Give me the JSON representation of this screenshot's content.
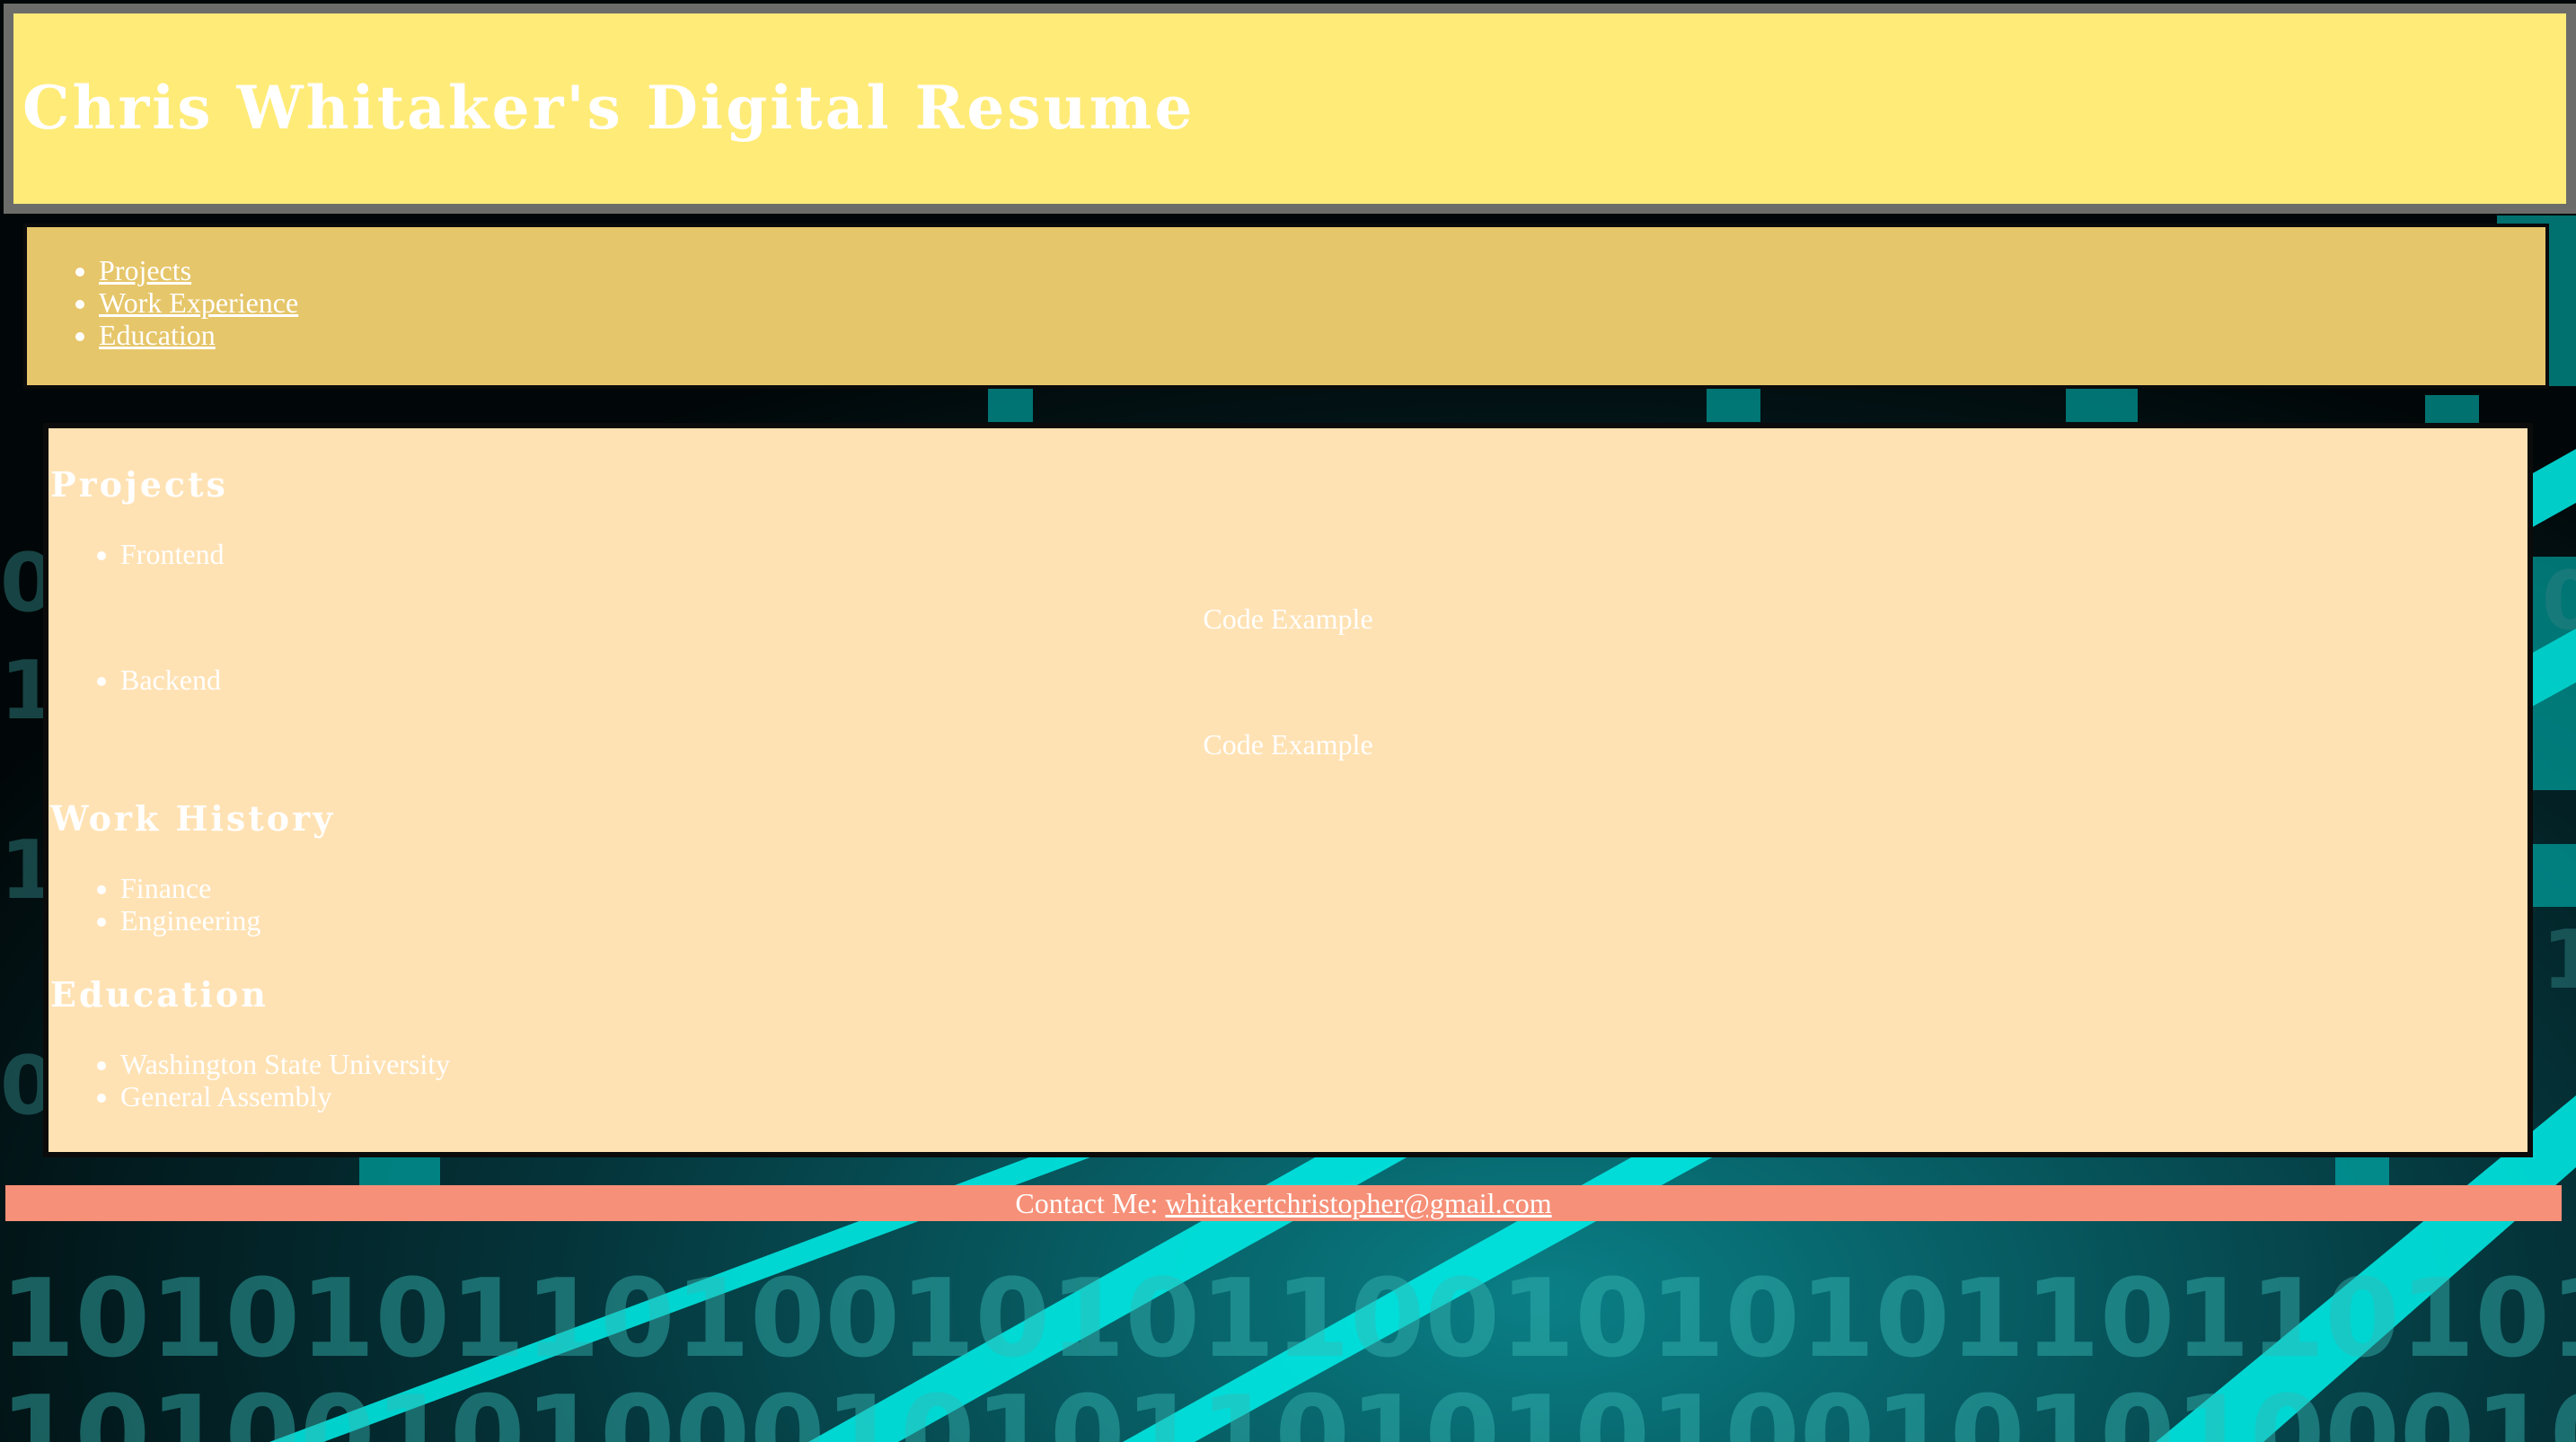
{
  "header": {
    "title": "Chris Whitaker's Digital Resume"
  },
  "nav": {
    "items": [
      {
        "label": "Projects"
      },
      {
        "label": "Work Experience"
      },
      {
        "label": "Education"
      }
    ]
  },
  "main": {
    "projects": {
      "heading": "Projects",
      "items": [
        {
          "label": "Frontend",
          "example": "Code Example"
        },
        {
          "label": "Backend",
          "example": "Code Example"
        }
      ]
    },
    "work_history": {
      "heading": "Work History",
      "items": [
        "Finance",
        "Engineering"
      ]
    },
    "education": {
      "heading": "Education",
      "items": [
        "Washington State University",
        "General Assembly"
      ]
    }
  },
  "footer": {
    "label": "Contact Me:",
    "email": "whitakertchristopher@gmail.com"
  },
  "colors": {
    "header_bg": "#ffeb78",
    "header_border": "#6c6d6a",
    "nav_bg": "#e6c66a",
    "main_bg": "#ffe2b4",
    "footer_bg": "#f69078",
    "background_accent": "#00e5e0"
  }
}
